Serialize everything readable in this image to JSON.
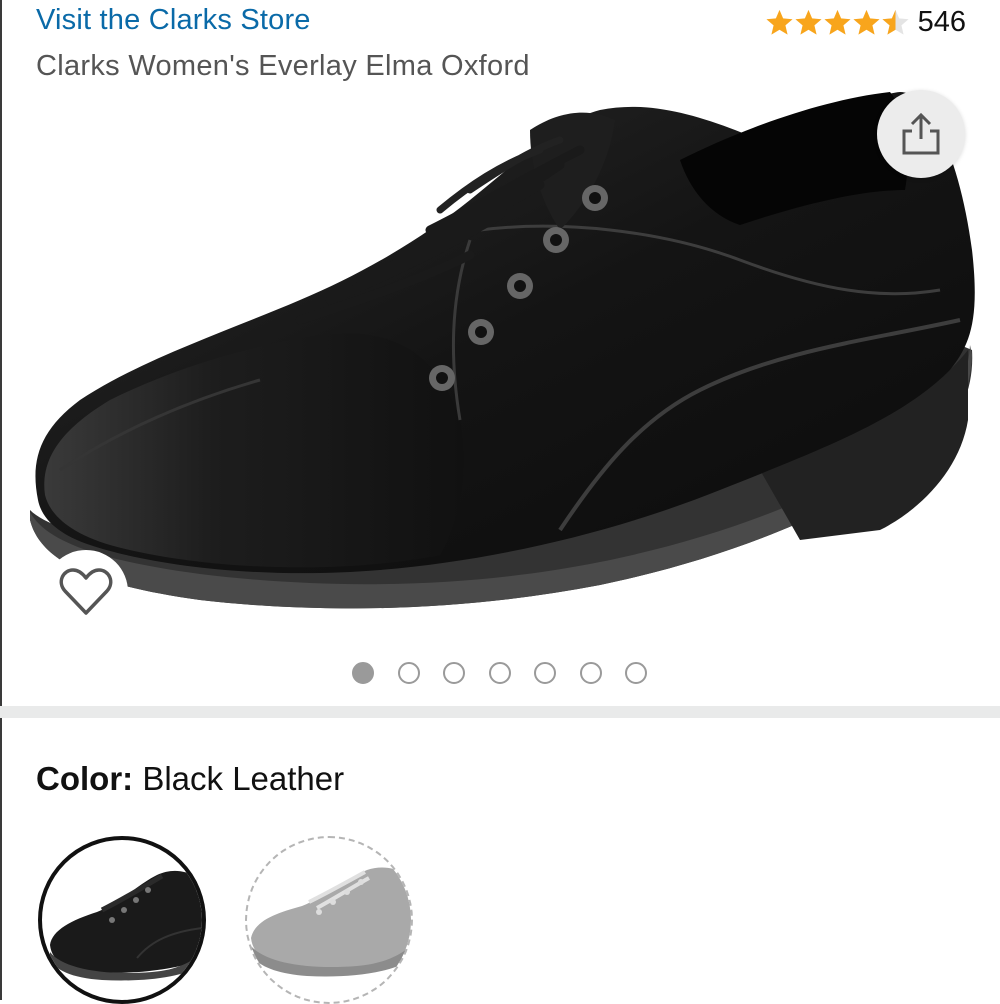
{
  "header": {
    "store_link": "Visit the Clarks Store",
    "rating_stars": 4.5,
    "rating_count": "546",
    "star_color": "#f8a51c",
    "product_title": "Clarks Women's Everlay Elma Oxford"
  },
  "gallery": {
    "image_icon": "shoe-image",
    "share_icon": "share-icon",
    "wishlist_icon": "heart-icon",
    "total_images": 7,
    "active_index": 0
  },
  "variation": {
    "color_label": "Color:",
    "color_value": "Black Leather",
    "swatches": [
      {
        "name": "Black Leather",
        "selected": true
      },
      {
        "name": "Grey",
        "selected": false
      }
    ]
  },
  "colors": {
    "link": "#0a6aa8",
    "divider": "#e9eaea"
  }
}
